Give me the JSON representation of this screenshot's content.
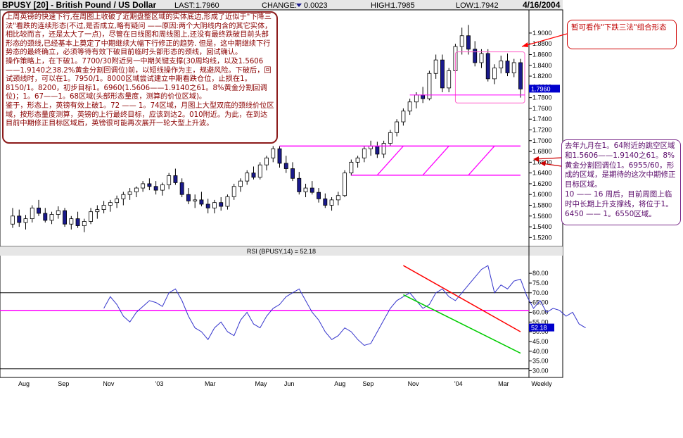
{
  "header": {
    "title": "BPUSY [20] - British Pound / US Dollar",
    "last_label": "LAST:",
    "last_value": "1.7960",
    "change_label": "CHANGE:",
    "change_value": "0.0023",
    "high_label": "HIGH:",
    "high_value": "1.7985",
    "low_label": "LOW:",
    "low_value": "1.7942",
    "date": "4/16/2004"
  },
  "annotations": {
    "main": "上周英镑的快速下行,在周图上收破了近期盘整区域的实体底边,形成了近似于\"下降三法\"看跌的连续形态(不过,是否成立,略有疑问 ——原因:两个大阴线内含的其它实体，相比较而言，还是太大了一点)，尽管在日线图和周线图上,还没有最终跌破目前头部形态的颈线,已经基本上奠定了中期继续大幅下行修正的趋势. 但是，这中期继续下行势态的最终确立，必须等待有效下破目前临时头部形态的颈线，回试确认。\n操作策略上，在下破1。7700/30附近另一中期关键支撑(30周均线，以及1.5606——1.9140之38.2%黄金分割回调位)前，以短线操作为主，规避风险。下破后，回试颈线时，可以在1。7950/1。8000区域尝试建立中期看跌仓位，止损在1。8150/1。8200，初步目标1。6960(1.5606——1.9140之61。8%黄金分割回调位)；1。67——1。68区域(头部形态量度，测算的价位区域)。\n鉴于，形态上，英镑有效上破1。72 —— 1。74区域，月图上大型双底的颈线价位区域，按形态量度测算，英镑的上行最终目标，应该到达2。010附近。为此，在到达目前中期修正目标区域后，英镑很可能再次展开一轮大型上升波。",
    "top_right": "暂可看作\"下跌三法\"组合形态",
    "right": "去年九月在1。64附近的跳空区域 和1.5606——1.9140之61。8%黄金分割回调位1。6955/60，形成的区域，是期待的这次中期修正目标区域。\n10 —— 16 周后，目前周图上临时中长期上升支撑线，将位于1。6450 —— 1。6550区域。"
  },
  "chart_data": [
    {
      "type": "candlestick",
      "title": "BPUSY [20] - British Pound / US Dollar",
      "period": "Weekly",
      "ylim": [
        1.51,
        1.93
      ],
      "y_ticks": [
        1.52,
        1.54,
        1.56,
        1.58,
        1.6,
        1.62,
        1.64,
        1.66,
        1.68,
        1.7,
        1.72,
        1.74,
        1.76,
        1.78,
        1.8,
        1.82,
        1.84,
        1.86,
        1.88,
        1.9
      ],
      "last_price_tag": "1.7960",
      "x_labels": [
        "Aug",
        "Sep",
        "Nov",
        "'03",
        "Mar",
        "May",
        "Jun",
        "Aug",
        "Sep",
        "Nov",
        "'04",
        "Mar",
        "Weekly"
      ],
      "colors": {
        "bull": "#ffffff",
        "bear": "#1a1a8c",
        "support": "#ff00ff",
        "tag": "#0000cc"
      },
      "candles": [
        [
          1.545,
          1.575,
          1.538,
          1.56
        ],
        [
          1.56,
          1.572,
          1.54,
          1.548
        ],
        [
          1.548,
          1.562,
          1.535,
          1.555
        ],
        [
          1.555,
          1.58,
          1.548,
          1.575
        ],
        [
          1.575,
          1.59,
          1.56,
          1.565
        ],
        [
          1.565,
          1.575,
          1.548,
          1.552
        ],
        [
          1.552,
          1.568,
          1.545,
          1.563
        ],
        [
          1.563,
          1.578,
          1.555,
          1.57
        ],
        [
          1.57,
          1.575,
          1.54,
          1.545
        ],
        [
          1.545,
          1.56,
          1.535,
          1.555
        ],
        [
          1.555,
          1.568,
          1.538,
          1.542
        ],
        [
          1.542,
          1.555,
          1.53,
          1.55
        ],
        [
          1.55,
          1.575,
          1.545,
          1.568
        ],
        [
          1.568,
          1.58,
          1.555,
          1.572
        ],
        [
          1.572,
          1.588,
          1.565,
          1.58
        ],
        [
          1.58,
          1.59,
          1.568,
          1.585
        ],
        [
          1.585,
          1.598,
          1.575,
          1.592
        ],
        [
          1.592,
          1.605,
          1.58,
          1.6
        ],
        [
          1.6,
          1.612,
          1.59,
          1.605
        ],
        [
          1.605,
          1.615,
          1.595,
          1.612
        ],
        [
          1.612,
          1.625,
          1.605,
          1.62
        ],
        [
          1.62,
          1.63,
          1.608,
          1.615
        ],
        [
          1.615,
          1.625,
          1.6,
          1.608
        ],
        [
          1.608,
          1.622,
          1.598,
          1.618
        ],
        [
          1.618,
          1.64,
          1.61,
          1.635
        ],
        [
          1.635,
          1.648,
          1.618,
          1.622
        ],
        [
          1.622,
          1.63,
          1.595,
          1.6
        ],
        [
          1.6,
          1.612,
          1.582,
          1.588
        ],
        [
          1.588,
          1.6,
          1.575,
          1.59
        ],
        [
          1.59,
          1.605,
          1.578,
          1.582
        ],
        [
          1.582,
          1.592,
          1.565,
          1.575
        ],
        [
          1.575,
          1.59,
          1.565,
          1.585
        ],
        [
          1.585,
          1.595,
          1.57,
          1.578
        ],
        [
          1.578,
          1.6,
          1.572,
          1.596
        ],
        [
          1.596,
          1.62,
          1.59,
          1.615
        ],
        [
          1.615,
          1.63,
          1.605,
          1.625
        ],
        [
          1.625,
          1.645,
          1.618,
          1.64
        ],
        [
          1.64,
          1.652,
          1.628,
          1.632
        ],
        [
          1.632,
          1.66,
          1.628,
          1.655
        ],
        [
          1.655,
          1.672,
          1.645,
          1.668
        ],
        [
          1.668,
          1.69,
          1.66,
          1.685
        ],
        [
          1.685,
          1.69,
          1.65,
          1.658
        ],
        [
          1.658,
          1.672,
          1.64,
          1.648
        ],
        [
          1.648,
          1.66,
          1.625,
          1.63
        ],
        [
          1.63,
          1.642,
          1.6,
          1.605
        ],
        [
          1.605,
          1.62,
          1.595,
          1.612
        ],
        [
          1.612,
          1.625,
          1.6,
          1.604
        ],
        [
          1.604,
          1.612,
          1.585,
          1.592
        ],
        [
          1.592,
          1.602,
          1.575,
          1.58
        ],
        [
          1.58,
          1.595,
          1.57,
          1.59
        ],
        [
          1.59,
          1.605,
          1.58,
          1.598
        ],
        [
          1.598,
          1.645,
          1.595,
          1.64
        ],
        [
          1.64,
          1.665,
          1.635,
          1.66
        ],
        [
          1.66,
          1.672,
          1.65,
          1.668
        ],
        [
          1.668,
          1.69,
          1.66,
          1.685
        ],
        [
          1.685,
          1.7,
          1.672,
          1.69
        ],
        [
          1.69,
          1.698,
          1.668,
          1.675
        ],
        [
          1.675,
          1.7,
          1.668,
          1.695
        ],
        [
          1.695,
          1.72,
          1.69,
          1.715
        ],
        [
          1.715,
          1.74,
          1.708,
          1.735
        ],
        [
          1.735,
          1.76,
          1.728,
          1.755
        ],
        [
          1.755,
          1.778,
          1.748,
          1.772
        ],
        [
          1.772,
          1.79,
          1.76,
          1.785
        ],
        [
          1.785,
          1.8,
          1.77,
          1.778
        ],
        [
          1.778,
          1.83,
          1.775,
          1.825
        ],
        [
          1.825,
          1.86,
          1.815,
          1.85
        ],
        [
          1.85,
          1.86,
          1.79,
          1.798
        ],
        [
          1.798,
          1.835,
          1.79,
          1.83
        ],
        [
          1.83,
          1.88,
          1.825,
          1.875
        ],
        [
          1.875,
          1.91,
          1.86,
          1.895
        ],
        [
          1.895,
          1.915,
          1.86,
          1.87
        ],
        [
          1.87,
          1.885,
          1.838,
          1.845
        ],
        [
          1.845,
          1.87,
          1.835,
          1.862
        ],
        [
          1.862,
          1.87,
          1.81,
          1.815
        ],
        [
          1.815,
          1.842,
          1.805,
          1.835
        ],
        [
          1.835,
          1.858,
          1.825,
          1.848
        ],
        [
          1.848,
          1.862,
          1.82,
          1.826
        ],
        [
          1.826,
          1.852,
          1.818,
          1.845
        ],
        [
          1.845,
          1.852,
          1.78,
          1.796
        ]
      ],
      "support_lines": [
        {
          "from_index": 41,
          "to_index": 78,
          "value": 1.69
        },
        {
          "from_index": 52,
          "to_index": 78,
          "value": 1.636
        }
      ],
      "box_levels": [
        1.77,
        1.865
      ],
      "ma_value": 1.785
    },
    {
      "type": "line",
      "title": "RSI (BPUSY,14) = 52.18",
      "ylim": [
        28,
        88
      ],
      "y_ticks": [
        30.0,
        35.0,
        40.0,
        45.0,
        50.0,
        55.0,
        60.0,
        65.0,
        70.0,
        75.0,
        80.0
      ],
      "reference_lines": [
        70,
        61,
        31
      ],
      "last_tag": "52.18",
      "series": [
        {
          "name": "",
          "color": "#3333cc",
          "start_index": 14,
          "values": [
            62,
            68,
            64,
            58,
            55,
            60,
            63,
            66,
            65,
            63,
            70,
            72,
            66,
            58,
            52,
            50,
            46,
            52,
            55,
            50,
            48,
            56,
            60,
            54,
            52,
            58,
            62,
            64,
            68,
            70,
            72,
            66,
            60,
            56,
            50,
            46,
            48,
            52,
            50,
            46,
            43,
            44,
            50,
            56,
            62,
            66,
            68,
            70,
            66,
            62,
            64,
            70,
            72,
            68,
            66,
            70,
            74,
            78,
            82,
            84,
            70,
            74,
            72,
            76,
            77,
            68,
            62,
            66,
            60,
            62,
            61,
            58,
            60,
            54,
            52
          ]
        }
      ],
      "trendlines": [
        {
          "color": "#ff0000",
          "from": [
            60,
            84
          ],
          "to": [
            78,
            50
          ]
        },
        {
          "color": "#00cc00",
          "from": [
            60,
            69
          ],
          "to": [
            78,
            39
          ]
        }
      ]
    }
  ]
}
